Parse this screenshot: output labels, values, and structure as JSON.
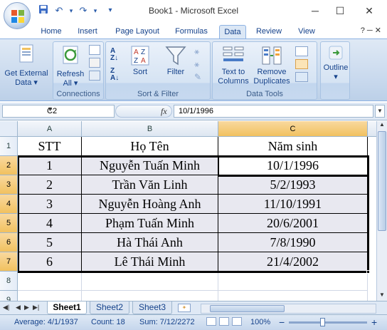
{
  "window": {
    "title": "Book1 - Microsoft Excel",
    "minimize": "─",
    "maximize": "☐",
    "close": "✕"
  },
  "qat": {
    "save_icon": "💾",
    "undo_icon": "↶",
    "undo_dd": "▾",
    "redo_icon": "↷",
    "redo_dd": "▾",
    "customize": "▾"
  },
  "tabs": [
    "Home",
    "Insert",
    "Page Layout",
    "Formulas",
    "Data",
    "Review",
    "View"
  ],
  "active_tab": "Data",
  "tab_help": "? ─ ✕",
  "ribbon": {
    "get_external_label": "Get External",
    "get_external_label2": "Data ▾",
    "refresh_label": "Refresh",
    "refresh_label2": "All ▾",
    "connections_group": "Connections",
    "sort_label": "Sort",
    "filter_label": "Filter",
    "sort_filter_group": "Sort & Filter",
    "text_to_columns_1": "Text to",
    "text_to_columns_2": "Columns",
    "remove_duplicates_1": "Remove",
    "remove_duplicates_2": "Duplicates",
    "data_tools_group": "Data Tools",
    "outline_label": "Outline",
    "outline_dd": "▾"
  },
  "formula_bar": {
    "name_box": "C2",
    "fx": "fx",
    "formula": "10/1/1996"
  },
  "columns": [
    "A",
    "B",
    "C"
  ],
  "rows": [
    "1",
    "2",
    "3",
    "4",
    "5",
    "6",
    "7",
    "8",
    "9"
  ],
  "table": {
    "headers": [
      "STT",
      "Họ Tên",
      "Năm sinh"
    ],
    "rows": [
      [
        "1",
        "Nguyễn Tuấn Minh",
        "10/1/1996"
      ],
      [
        "2",
        "Trần Văn Linh",
        "5/2/1993"
      ],
      [
        "3",
        "Nguyễn Hoàng Anh",
        "11/10/1991"
      ],
      [
        "4",
        "Phạm Tuấn Minh",
        "20/6/2001"
      ],
      [
        "5",
        "Hà Thái Anh",
        "7/8/1990"
      ],
      [
        "6",
        "Lê Thái Minh",
        "21/4/2002"
      ]
    ]
  },
  "sheets": [
    "Sheet1",
    "Sheet2",
    "Sheet3"
  ],
  "active_sheet": "Sheet1",
  "status": {
    "average": "Average: 4/1/1937",
    "count": "Count: 18",
    "sum": "Sum: 7/12/2272",
    "zoom": "100%",
    "zoom_minus": "−",
    "zoom_plus": "+"
  },
  "colors": {
    "accent": "#15428b",
    "ribbon": "#dfe9f5",
    "selection_header": "#f1c15f",
    "shade": "#e8e8f0"
  }
}
